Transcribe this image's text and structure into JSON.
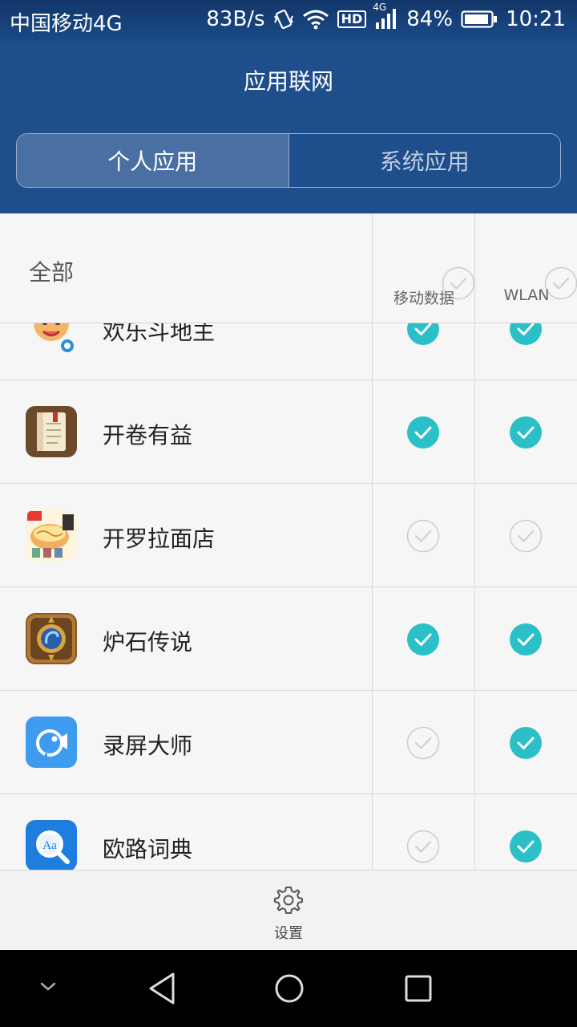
{
  "status_bar": {
    "carrier": "中国移动4G",
    "net_speed": "83B/s",
    "hd_badge": "HD",
    "signal_type": "4G",
    "battery": "84%",
    "time": "10:21"
  },
  "header": {
    "title": "应用联网",
    "tabs": [
      {
        "label": "个人应用",
        "active": true
      },
      {
        "label": "系统应用",
        "active": false
      }
    ]
  },
  "list_header": {
    "all_label": "全部",
    "columns": [
      {
        "label": "移动数据",
        "checked": false
      },
      {
        "label": "WLAN",
        "checked": false
      }
    ]
  },
  "apps": [
    {
      "name": "欢乐斗地主",
      "icon": "doudizhu-icon",
      "mobile": true,
      "wlan": true
    },
    {
      "name": "开卷有益",
      "icon": "book-icon",
      "mobile": true,
      "wlan": true
    },
    {
      "name": "开罗拉面店",
      "icon": "ramen-icon",
      "mobile": false,
      "wlan": false
    },
    {
      "name": "炉石传说",
      "icon": "hearthstone-icon",
      "mobile": true,
      "wlan": true
    },
    {
      "name": "录屏大师",
      "icon": "screen-recorder-icon",
      "mobile": false,
      "wlan": true
    },
    {
      "name": "欧路词典",
      "icon": "dictionary-icon",
      "mobile": false,
      "wlan": true
    }
  ],
  "toolbar": {
    "settings_label": "设置",
    "settings_icon": "gear-icon"
  },
  "colors": {
    "header_bg": "#1f4e8c",
    "active_tab": "#4a70a3",
    "check_on": "#2bbfc7",
    "check_off": "#cccccc"
  }
}
